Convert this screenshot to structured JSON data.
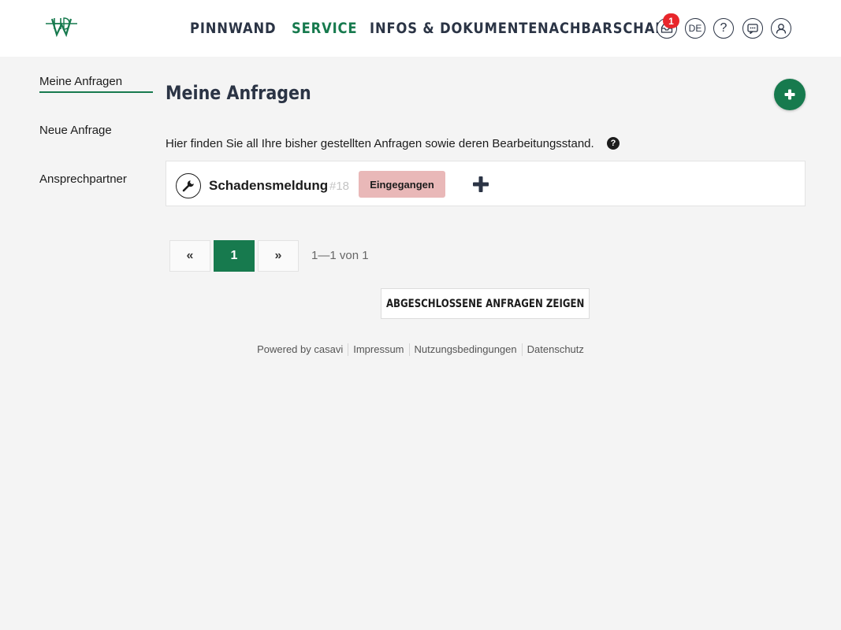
{
  "header": {
    "nav": [
      "PINNWAND",
      "SERVICE",
      "INFOS & DOKUMENTE",
      "NACHBARSCHAFT"
    ],
    "active_nav": "SERVICE",
    "notification_count": "1",
    "language": "DE",
    "icons": [
      "logo-hd-w",
      "inbox-icon",
      "language-icon",
      "help-icon",
      "chat-icon",
      "user-icon"
    ]
  },
  "sidebar": {
    "items": [
      "Meine Anfragen",
      "Neue Anfrage",
      "Ansprechpartner"
    ],
    "active": "Meine Anfragen"
  },
  "main": {
    "title": "Meine Anfragen",
    "intro": "Hier finden Sie all Ihre bisher gestellten Anfragen sowie deren Bearbeitungsstand.",
    "requests": [
      {
        "title": "Schadensmeldung",
        "number": "#18",
        "status": "Eingegangen"
      }
    ],
    "pagination": {
      "prev": "«",
      "page": "1",
      "next": "»",
      "info": "1—1 von 1"
    },
    "closed_button": "ABGESCHLOSSENE ANFRAGEN ZEIGEN"
  },
  "footer": {
    "powered_by": "Powered by casavi",
    "links": [
      "Impressum",
      "Nutzungsbedingungen",
      "Datenschutz"
    ]
  },
  "colors": {
    "brand": "#177a4e",
    "badge_red": "#e8262b",
    "status_received": "#e9b8b8",
    "nav_text": "#2b3445",
    "background": "#f4f4f4"
  }
}
